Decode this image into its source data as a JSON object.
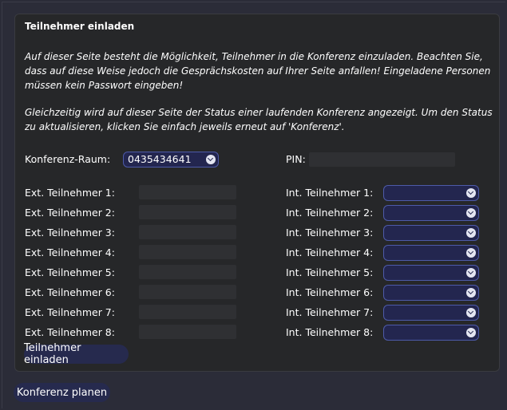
{
  "panel": {
    "title": "Teilnehmer einladen",
    "intro_1": "Auf dieser Seite besteht die Möglichkeit, Teilnehmer in die Konferenz einzuladen. Beachten Sie, dass auf diese Weise jedoch die Gesprächskosten auf Ihrer Seite anfallen! Eingeladene Personen müssen kein Passwort eingeben!",
    "intro_2": "Gleichzeitig wird auf dieser Seite der Status einer laufenden Konferenz angezeigt. Um den Status zu aktualisieren, klicken Sie einfach jeweils erneut auf 'Konferenz'."
  },
  "room": {
    "label": "Konferenz-Raum:",
    "value": "0435434641",
    "pin_label": "PIN:",
    "pin_value": ""
  },
  "participants": {
    "ext_labels": [
      "Ext. Teilnehmer 1:",
      "Ext. Teilnehmer 2:",
      "Ext. Teilnehmer 3:",
      "Ext. Teilnehmer 4:",
      "Ext. Teilnehmer 5:",
      "Ext. Teilnehmer 6:",
      "Ext. Teilnehmer 7:",
      "Ext. Teilnehmer 8:"
    ],
    "int_labels": [
      "Int. Teilnehmer 1:",
      "Int. Teilnehmer 2:",
      "Int. Teilnehmer 3:",
      "Int. Teilnehmer 4:",
      "Int. Teilnehmer 5:",
      "Int. Teilnehmer 6:",
      "Int. Teilnehmer 7:",
      "Int. Teilnehmer 8:"
    ]
  },
  "buttons": {
    "invite": "Teilnehmer einladen",
    "plan": "Konferenz planen"
  },
  "colors": {
    "background": "#2b2c38",
    "panel": "#262729",
    "select_bg": "#23264f",
    "select_border": "#4d5aa8",
    "button_bg": "#262a4e"
  }
}
